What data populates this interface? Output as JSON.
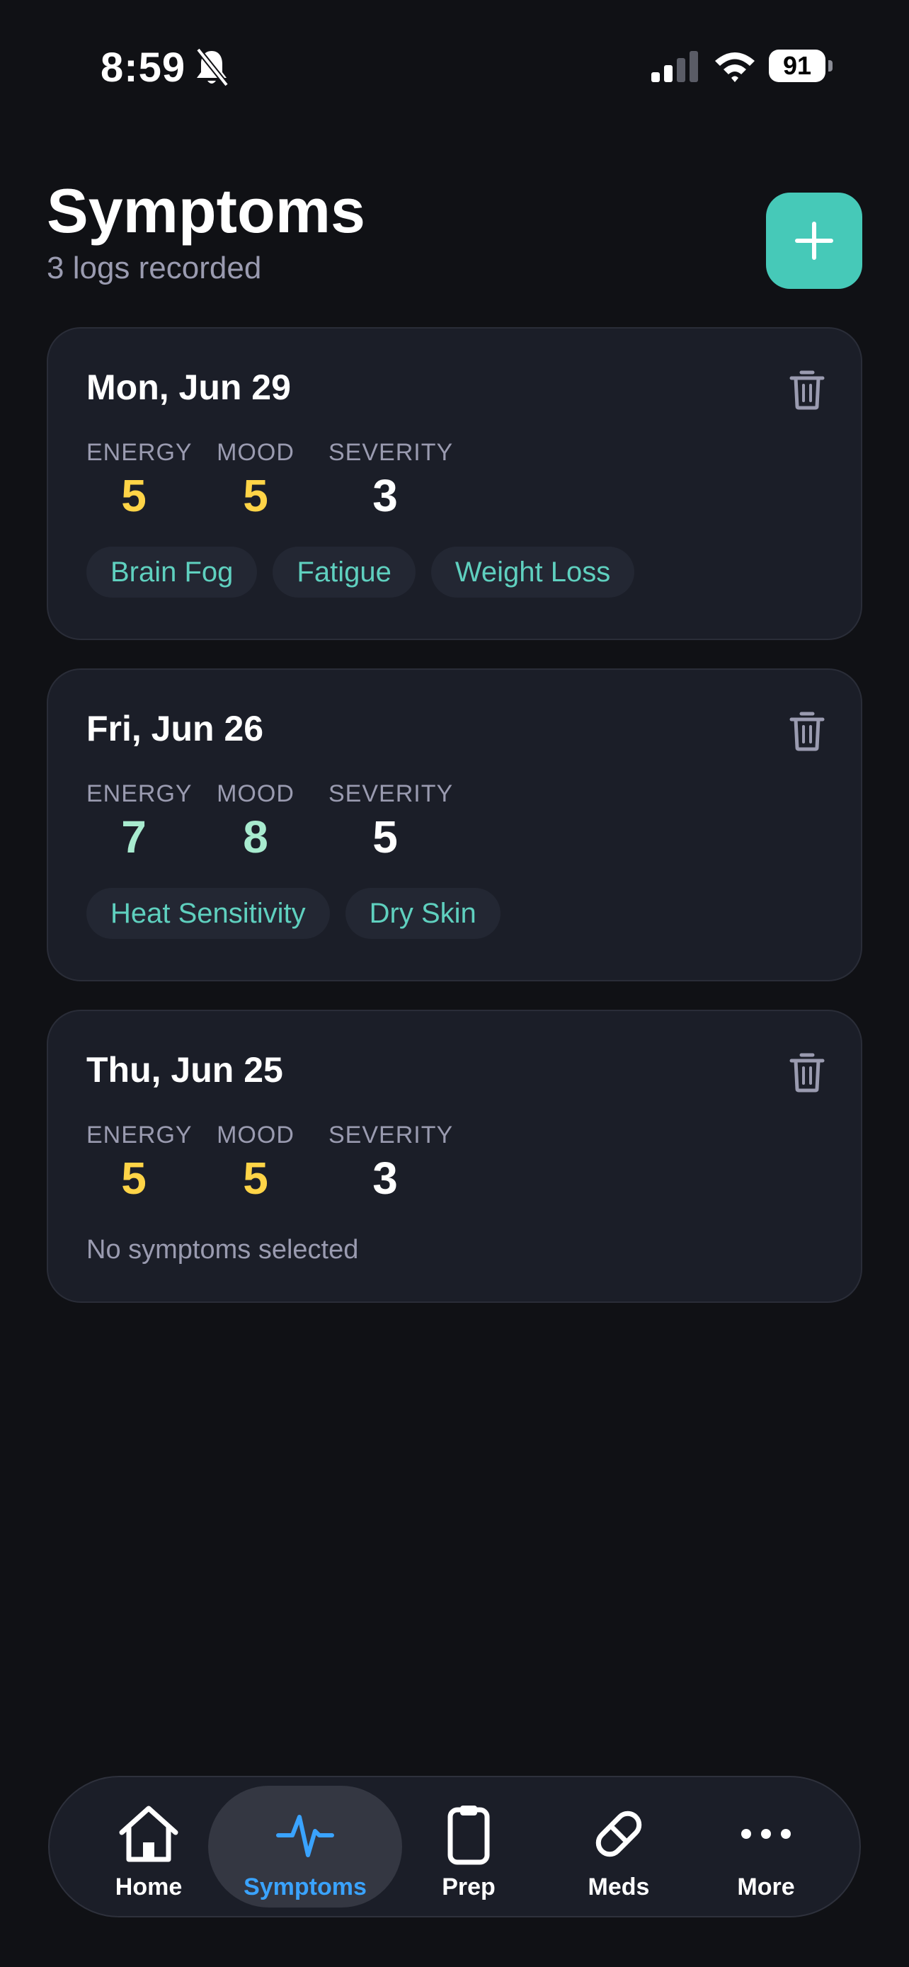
{
  "status_bar": {
    "time": "8:59",
    "battery": "91"
  },
  "header": {
    "title": "Symptoms",
    "subtitle": "3 logs recorded"
  },
  "colors": {
    "accent": "#46c9b8",
    "tag_text": "#5fd0bf",
    "value_yellow": "#ffd447",
    "value_green": "#a8ebcf",
    "value_white": "#ffffff",
    "active_tab": "#3aa3ff"
  },
  "metric_labels": {
    "energy": "ENERGY",
    "mood": "MOOD",
    "severity": "SEVERITY"
  },
  "logs": [
    {
      "date": "Mon, Jun 29",
      "energy": "5",
      "mood": "5",
      "severity": "3",
      "tags": [
        "Brain Fog",
        "Fatigue",
        "Weight Loss"
      ]
    },
    {
      "date": "Fri, Jun 26",
      "energy": "7",
      "mood": "8",
      "severity": "5",
      "tags": [
        "Heat Sensitivity",
        "Dry Skin"
      ]
    },
    {
      "date": "Thu, Jun 25",
      "energy": "5",
      "mood": "5",
      "severity": "3",
      "empty_text": "No symptoms selected"
    }
  ],
  "tabs": [
    {
      "label": "Home",
      "icon": "home-icon"
    },
    {
      "label": "Symptoms",
      "icon": "pulse-icon",
      "active": true
    },
    {
      "label": "Prep",
      "icon": "clipboard-icon"
    },
    {
      "label": "Meds",
      "icon": "pill-icon"
    },
    {
      "label": "More",
      "icon": "more-icon"
    }
  ]
}
